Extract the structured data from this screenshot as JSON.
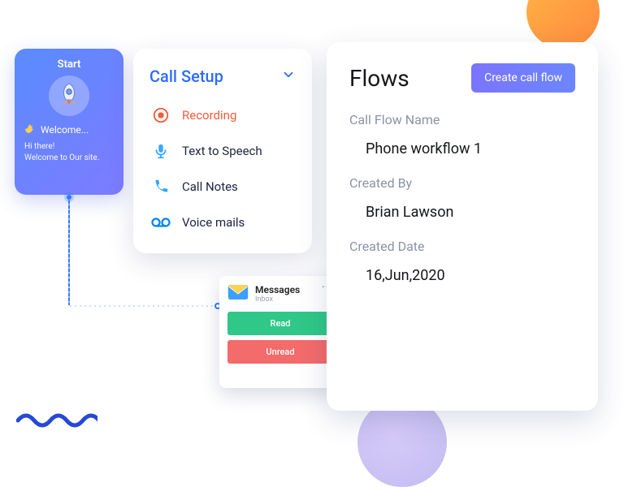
{
  "start": {
    "title": "Start",
    "welcome_label": "Welcome...",
    "line1": "Hi there!",
    "line2": "Welcome to Our site."
  },
  "setup": {
    "title": "Call Setup",
    "items": [
      {
        "label": "Recording"
      },
      {
        "label": "Text to Speech"
      },
      {
        "label": "Call Notes"
      },
      {
        "label": "Voice mails"
      }
    ]
  },
  "messages": {
    "title": "Messages",
    "subtitle": "Inbox",
    "more": "···",
    "read_label": "Read",
    "unread_label": "Unread"
  },
  "flows": {
    "title": "Flows",
    "create_label": "Create call flow",
    "fields": [
      {
        "label": "Call Flow Name",
        "value": "Phone workflow 1"
      },
      {
        "label": "Created By",
        "value": "Brian Lawson"
      },
      {
        "label": "Created Date",
        "value": "16,Jun,2020"
      }
    ]
  }
}
